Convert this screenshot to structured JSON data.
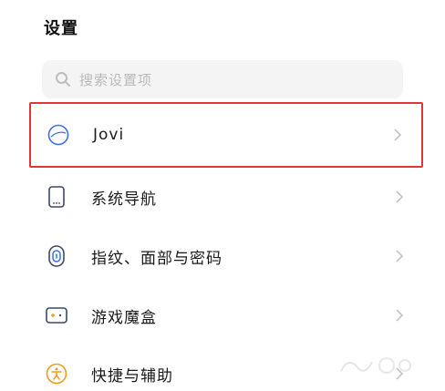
{
  "header": {
    "title": "设置"
  },
  "search": {
    "placeholder": "搜索设置项"
  },
  "settings_items": [
    {
      "label": "Jovi",
      "icon": "jovi-icon"
    },
    {
      "label": "系统导航",
      "icon": "phone-navigation-icon"
    },
    {
      "label": "指纹、面部与密码",
      "icon": "fingerprint-icon"
    },
    {
      "label": "游戏魔盒",
      "icon": "game-box-icon"
    },
    {
      "label": "快捷与辅助",
      "icon": "accessibility-icon"
    }
  ],
  "colors": {
    "accent": "#3c6df0",
    "highlight_border": "#e23535",
    "accessibility_icon": "#f29b1d"
  }
}
